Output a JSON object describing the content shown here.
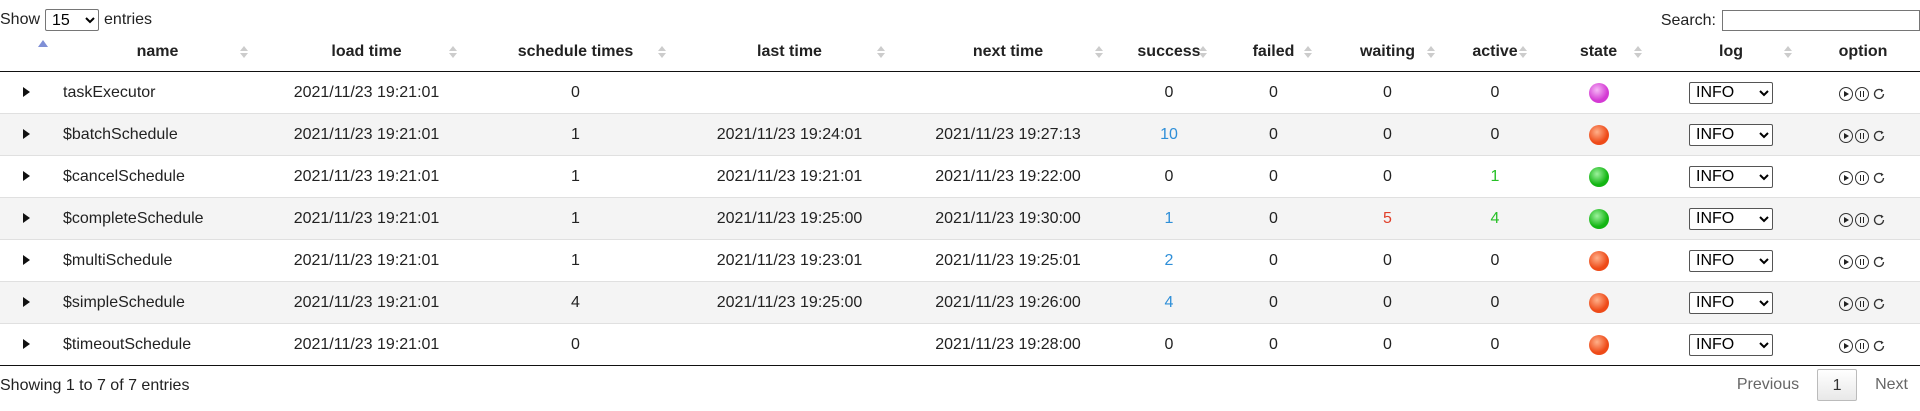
{
  "controls": {
    "show_label": "Show",
    "entries_label": "entries",
    "page_size": "15",
    "page_size_options": [
      "15"
    ],
    "search_label": "Search:",
    "search_value": ""
  },
  "columns": [
    "name",
    "load time",
    "schedule times",
    "last time",
    "next time",
    "success",
    "failed",
    "waiting",
    "active",
    "state",
    "log",
    "option"
  ],
  "colors": {
    "state_magenta": "#d43ad4",
    "state_red": "#ee4a18",
    "state_green": "#13b513",
    "num_blue": "#2f8fd8",
    "num_red": "#e0402a",
    "num_green": "#27c027"
  },
  "rows": [
    {
      "name": "taskExecutor",
      "load_time": "2021/11/23 19:21:01",
      "schedule_times": "0",
      "last_time": "",
      "next_time": "",
      "success": "0",
      "failed": "0",
      "waiting": "0",
      "active": "0",
      "state": "magenta",
      "log": "INFO"
    },
    {
      "name": "$batchSchedule",
      "load_time": "2021/11/23 19:21:01",
      "schedule_times": "1",
      "last_time": "2021/11/23 19:24:01",
      "next_time": "2021/11/23 19:27:13",
      "success": "10",
      "failed": "0",
      "waiting": "0",
      "active": "0",
      "state": "red",
      "log": "INFO"
    },
    {
      "name": "$cancelSchedule",
      "load_time": "2021/11/23 19:21:01",
      "schedule_times": "1",
      "last_time": "2021/11/23 19:21:01",
      "next_time": "2021/11/23 19:22:00",
      "success": "0",
      "failed": "0",
      "waiting": "0",
      "active": "1",
      "state": "green",
      "log": "INFO"
    },
    {
      "name": "$completeSchedule",
      "load_time": "2021/11/23 19:21:01",
      "schedule_times": "1",
      "last_time": "2021/11/23 19:25:00",
      "next_time": "2021/11/23 19:30:00",
      "success": "1",
      "failed": "0",
      "waiting": "5",
      "active": "4",
      "state": "green",
      "log": "INFO"
    },
    {
      "name": "$multiSchedule",
      "load_time": "2021/11/23 19:21:01",
      "schedule_times": "1",
      "last_time": "2021/11/23 19:23:01",
      "next_time": "2021/11/23 19:25:01",
      "success": "2",
      "failed": "0",
      "waiting": "0",
      "active": "0",
      "state": "red",
      "log": "INFO"
    },
    {
      "name": "$simpleSchedule",
      "load_time": "2021/11/23 19:21:01",
      "schedule_times": "4",
      "last_time": "2021/11/23 19:25:00",
      "next_time": "2021/11/23 19:26:00",
      "success": "4",
      "failed": "0",
      "waiting": "0",
      "active": "0",
      "state": "red",
      "log": "INFO"
    },
    {
      "name": "$timeoutSchedule",
      "load_time": "2021/11/23 19:21:01",
      "schedule_times": "0",
      "last_time": "",
      "next_time": "2021/11/23 19:28:00",
      "success": "0",
      "failed": "0",
      "waiting": "0",
      "active": "0",
      "state": "red",
      "log": "INFO"
    }
  ],
  "footer": {
    "info": "Showing 1 to 7 of 7 entries",
    "previous": "Previous",
    "current_page": "1",
    "next": "Next"
  }
}
